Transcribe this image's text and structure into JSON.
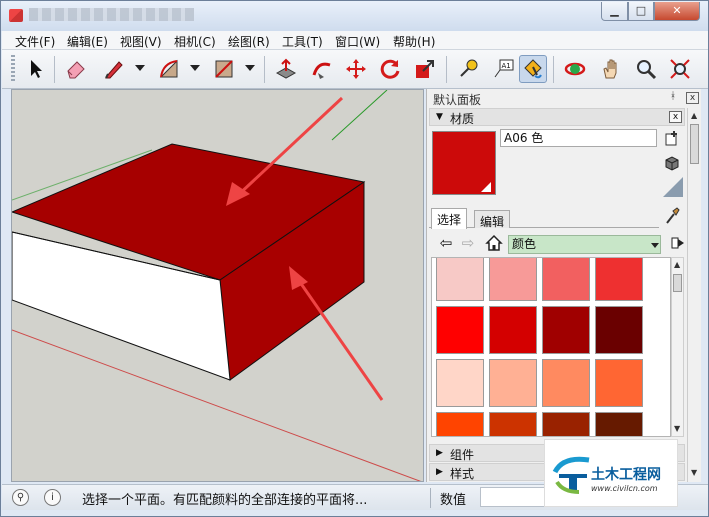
{
  "window": {
    "title_icon": "sketchup-app-icon",
    "buttons": {
      "minimize": "▁",
      "maximize": "□",
      "close": "✕"
    }
  },
  "menu": [
    "文件(F)",
    "编辑(E)",
    "视图(V)",
    "相机(C)",
    "绘图(R)",
    "工具(T)",
    "窗口(W)",
    "帮助(H)"
  ],
  "toolbar": {
    "tools": [
      "select-tool",
      "eraser-tool",
      "pencil-line-tool",
      "arc-tool",
      "rectangle-tool",
      "push-pull-tool",
      "follow-me-tool",
      "move-tool",
      "rotate-tool",
      "scale-tool",
      "tape-measure-tool",
      "text-tool",
      "paint-bucket-tool",
      "orbit-tool",
      "pan-tool",
      "zoom-tool",
      "zoom-extents-tool"
    ],
    "text_tool_label": "A1",
    "active_tool": "paint-bucket-tool"
  },
  "tray": {
    "title": "默认面板",
    "pin": "ª",
    "close": "x",
    "materials": {
      "title": "材质",
      "close": "x",
      "current_name": "A06 色",
      "current_color": "#cc0a0a",
      "tabs": [
        "选择",
        "编辑"
      ],
      "active_tab": "选择",
      "collection": "颜色",
      "swatches": [
        "#f7c9c6",
        "#f79a98",
        "#f26060",
        "#ee3030",
        "#ff0000",
        "#d40000",
        "#a00000",
        "#6a0000",
        "#ffd6c8",
        "#ffb094",
        "#ff8a60",
        "#ff6633",
        "#ff4400",
        "#cc3300",
        "#992200",
        "#661a00"
      ]
    },
    "collapsed_sections": [
      "组件",
      "样式"
    ]
  },
  "status": {
    "text": "选择一个平面。有匹配颜料的全部连接的平面将...",
    "measure_label": "数值",
    "measure_value": ""
  },
  "watermark": {
    "name": "土木工程网",
    "url": "www.civilcn.com"
  }
}
